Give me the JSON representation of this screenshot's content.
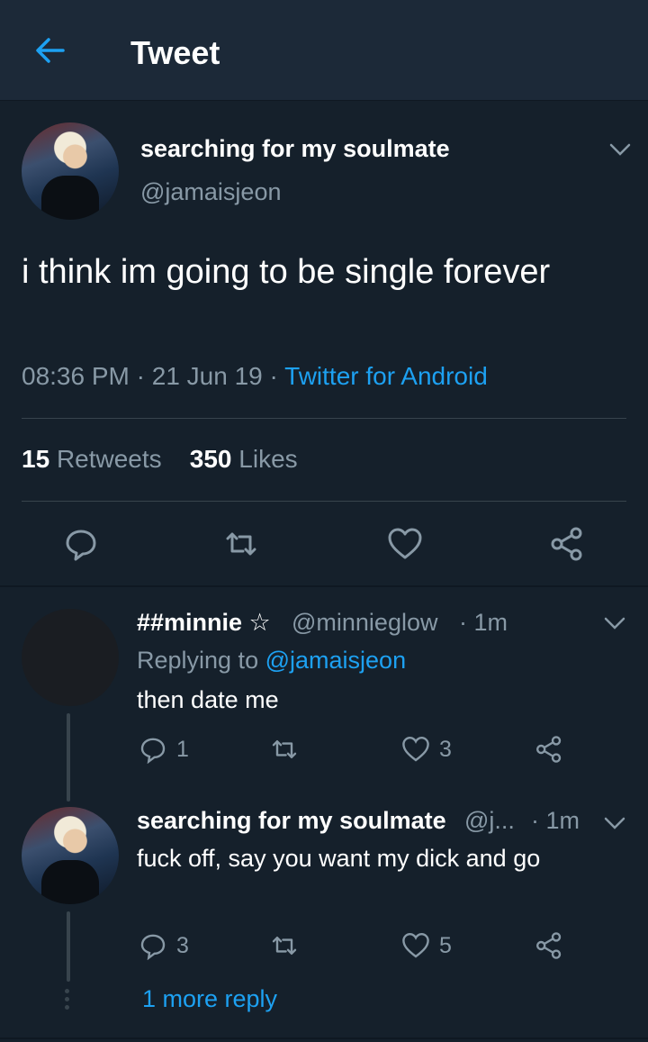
{
  "header": {
    "title": "Tweet",
    "back_icon": "back-arrow-icon",
    "accent": "#1da1f2"
  },
  "tweet": {
    "author_name": "searching for my soulmate",
    "author_handle": "@jamaisjeon",
    "text": "i think im going to be single forever",
    "time": "08:36 PM",
    "date": "21 Jun 19",
    "sep": "·",
    "source": "Twitter for Android",
    "retweets_count": "15",
    "retweets_label": "Retweets",
    "likes_count": "350",
    "likes_label": "Likes"
  },
  "replies": [
    {
      "name": "##minnie ☆",
      "handle": "@minnieglow",
      "time": "· 1m",
      "replying_prefix": "Replying to",
      "replying_to": "@jamaisjeon",
      "text": "then date me",
      "reply_count": "1",
      "retweet_count": "",
      "like_count": "3"
    },
    {
      "name": "searching for my soulmate",
      "handle": "@j...",
      "time": "· 1m",
      "text": "fuck off, say you want my dick and go",
      "reply_count": "3",
      "retweet_count": "",
      "like_count": "5"
    }
  ],
  "more_replies": "1 more reply",
  "colors": {
    "background": "#15202b",
    "header": "#1c2938",
    "muted": "#8899a6",
    "link": "#1da1f2"
  }
}
